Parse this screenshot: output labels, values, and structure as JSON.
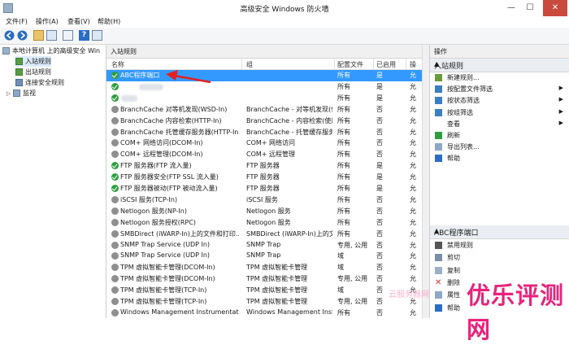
{
  "window": {
    "title": "高级安全 Windows 防火墙",
    "min": "—",
    "max": "☐",
    "close": "✕"
  },
  "menu": [
    "文件(F)",
    "操作(A)",
    "查看(V)",
    "帮助(H)"
  ],
  "tree": {
    "root": "本地计算机 上的高级安全 Win",
    "items": [
      "入站规则",
      "出站规则",
      "连接安全规则",
      "监视"
    ]
  },
  "center": {
    "title": "入站规则",
    "columns": {
      "name": "名称",
      "group": "组",
      "profile": "配置文件",
      "enabled": "已启用",
      "action": "操"
    },
    "rows": [
      {
        "name": "ABC程序端口",
        "group": "",
        "profile": "所有",
        "enabled": "是",
        "action": "允"
      },
      {
        "name": "",
        "group": "",
        "profile": "所有",
        "enabled": "是",
        "action": "允"
      },
      {
        "name": "",
        "group": "",
        "profile": "所有",
        "enabled": "是",
        "action": "允"
      },
      {
        "name": "BranchCache 对等机发现(WSD-In)",
        "group": "BranchCache - 对等机发现(使用...",
        "profile": "所有",
        "enabled": "否",
        "action": "允"
      },
      {
        "name": "BranchCache 内容检索(HTTP-In)",
        "group": "BranchCache - 内容检索(使用 H...",
        "profile": "所有",
        "enabled": "否",
        "action": "允"
      },
      {
        "name": "BranchCache 托管缓存服务器(HTTP-In)",
        "group": "BranchCache - 托管缓存服务器(...",
        "profile": "所有",
        "enabled": "否",
        "action": "允"
      },
      {
        "name": "COM+ 网络访问(DCOM-In)",
        "group": "COM+ 网络访问",
        "profile": "所有",
        "enabled": "否",
        "action": "允"
      },
      {
        "name": "COM+ 远程管理(DCOM-In)",
        "group": "COM+ 远程管理",
        "profile": "所有",
        "enabled": "否",
        "action": "允"
      },
      {
        "name": "FTP 服务器(FTP 流入量)",
        "group": "FTP 服务器",
        "profile": "所有",
        "enabled": "是",
        "action": "允"
      },
      {
        "name": "FTP 服务器安全(FTP SSL 流入量)",
        "group": "FTP 服务器",
        "profile": "所有",
        "enabled": "是",
        "action": "允"
      },
      {
        "name": "FTP 服务器被动(FTP 被动流入量)",
        "group": "FTP 服务器",
        "profile": "所有",
        "enabled": "是",
        "action": "允"
      },
      {
        "name": "iSCSI 服务(TCP-In)",
        "group": "iSCSI 服务",
        "profile": "所有",
        "enabled": "否",
        "action": "允"
      },
      {
        "name": "Netlogon 服务(NP-In)",
        "group": "Netlogon 服务",
        "profile": "所有",
        "enabled": "否",
        "action": "允"
      },
      {
        "name": "Netlogon 服务授权(RPC)",
        "group": "Netlogon 服务",
        "profile": "所有",
        "enabled": "否",
        "action": "允"
      },
      {
        "name": "SMBDirect (iWARP-In)上的文件和打印...",
        "group": "SMBDirect (iWARP-In)上的文件和打印...",
        "profile": "所有",
        "enabled": "否",
        "action": "允"
      },
      {
        "name": "SNMP Trap Service (UDP In)",
        "group": "SNMP Trap",
        "profile": "专用, 公用",
        "enabled": "否",
        "action": "允"
      },
      {
        "name": "SNMP Trap Service (UDP In)",
        "group": "SNMP Trap",
        "profile": "域",
        "enabled": "否",
        "action": "允"
      },
      {
        "name": "TPM 虚拟智能卡管理(DCOM-In)",
        "group": "TPM 虚拟智能卡管理",
        "profile": "域",
        "enabled": "否",
        "action": "允"
      },
      {
        "name": "TPM 虚拟智能卡管理(DCOM-In)",
        "group": "TPM 虚拟智能卡管理",
        "profile": "专用, 公用",
        "enabled": "否",
        "action": "允"
      },
      {
        "name": "TPM 虚拟智能卡管理(TCP-In)",
        "group": "TPM 虚拟智能卡管理",
        "profile": "域",
        "enabled": "否",
        "action": "允"
      },
      {
        "name": "TPM 虚拟智能卡管理(TCP-In)",
        "group": "TPM 虚拟智能卡管理",
        "profile": "专用, 公用",
        "enabled": "否",
        "action": "允"
      },
      {
        "name": "Windows Management Instrumentati...",
        "group": "Windows Management Instr...",
        "profile": "所有",
        "enabled": "否",
        "action": "允"
      }
    ]
  },
  "actions": {
    "title": "操作",
    "section1": "入站规则",
    "section1_items": [
      "新建规则...",
      "按配置文件筛选",
      "按状态筛选",
      "按组筛选",
      "查看",
      "刷新",
      "导出列表...",
      "帮助"
    ],
    "section2": "ABC程序端口",
    "section2_items": [
      "禁用规则",
      "剪切",
      "复制",
      "删除",
      "属性",
      "帮助"
    ]
  },
  "watermark": {
    "small": "云服务器网",
    "large": "优乐评测网"
  },
  "colors": {
    "selection": "#3399ff",
    "enabled_icon": "#2e9e3e",
    "disabled_icon": "#8f8f8f",
    "arrow": "#e32020",
    "watermark": "#e8237c"
  }
}
